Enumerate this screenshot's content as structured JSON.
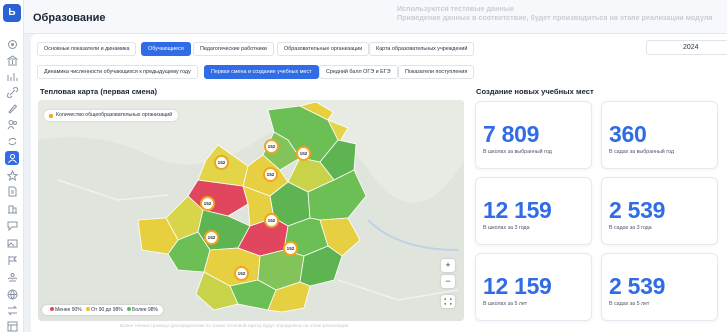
{
  "app": {
    "logo": "Ь"
  },
  "header": {
    "title": "Образование",
    "notice_line1": "Используются тестовые данные",
    "notice_line2": "Приведение данных в соответствие, будет производиться на этапе реализации модуля"
  },
  "sidebar": {
    "icons": [
      "target-icon",
      "institution-icon",
      "chart-icon",
      "link-icon",
      "brush-icon",
      "users-icon",
      "sync-icon",
      "person-icon",
      "star-icon",
      "document-icon",
      "building-icon",
      "chat-icon",
      "image-icon",
      "flag-icon",
      "hands-icon",
      "globe-icon",
      "transfer-icon",
      "table-icon"
    ],
    "active_index": 7
  },
  "tabs_primary": [
    {
      "label": "Основные показатели и динамика",
      "active": false
    },
    {
      "label": "Обучающиеся",
      "active": true
    },
    {
      "label": "Педагогические работники",
      "active": false
    },
    {
      "label": "Образовательные организации",
      "active": false
    },
    {
      "label": "Карта образовательных учреждений",
      "active": false
    }
  ],
  "year_select": {
    "value": "2024"
  },
  "tabs_secondary": [
    {
      "label": "Динамика численности обучающихся к предыдущему году",
      "active": false
    },
    {
      "label": "Первая смена и создание учебных мест",
      "active": true
    },
    {
      "label": "Средний балл ОГЭ и ЕГЭ",
      "active": false
    },
    {
      "label": "Показатели поступления",
      "active": false
    }
  ],
  "heatmap": {
    "title": "Тепловая карта (первая смена)",
    "legend_top": "Количество общеобразовательных организаций",
    "markers": [
      "152",
      "152",
      "152",
      "152",
      "152",
      "152",
      "152",
      "152",
      "152"
    ],
    "legend_bottom": [
      {
        "label": "Менее 90%",
        "color": "#e0475f"
      },
      {
        "label": "От 90 до 98%",
        "color": "#f2c518"
      },
      {
        "label": "Более 98%",
        "color": "#5cb85c"
      }
    ],
    "zoom_in": "+",
    "zoom_out": "−",
    "footnote": "Более точные границы (распределение по зонам тепловой карты) будут определены на этапе реализации"
  },
  "places": {
    "title": "Создание новых учебных мест",
    "cards": [
      {
        "value": "7 809",
        "caption": "В школах за выбранный год"
      },
      {
        "value": "360",
        "caption": "В садах за выбранный год"
      },
      {
        "value": "12 159",
        "caption": "В школах за 3 года"
      },
      {
        "value": "2 539",
        "caption": "В садах за 3 года"
      },
      {
        "value": "12 159",
        "caption": "В школах за 5 лет"
      },
      {
        "value": "2 539",
        "caption": "В садах за 5 лет"
      }
    ]
  },
  "colors": {
    "accent": "#2f6ce5",
    "low": "#e0475f",
    "mid": "#f2c518",
    "high": "#5cb85c"
  }
}
